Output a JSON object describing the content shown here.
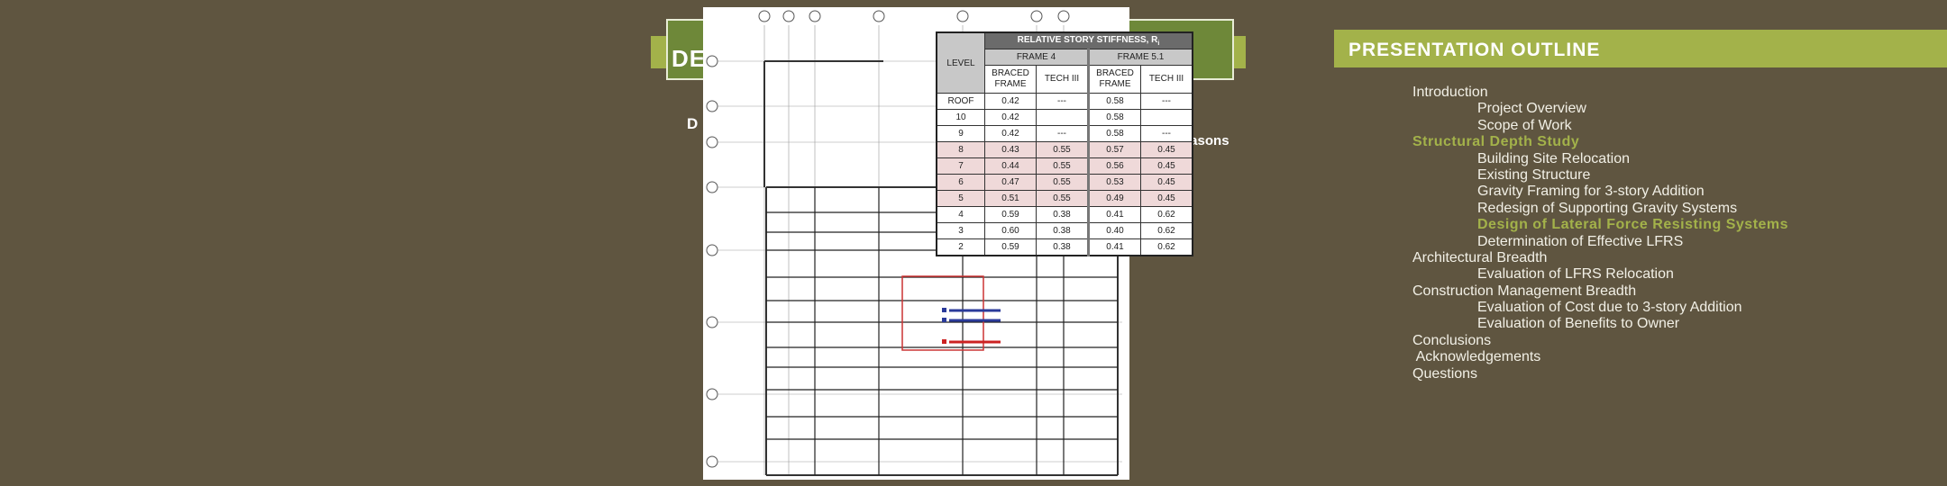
{
  "colors": {
    "background": "#5f5540",
    "accent_green": "#a3b24a",
    "dark_green": "#6e8839",
    "highlight_row": "#efd9d9"
  },
  "left_slide": {
    "title_fragment": "DE",
    "subtitle_fragment": "D",
    "body_fragment": "reasons"
  },
  "stiffness_table": {
    "title": "RELATIVE STORY STIFFNESS, R",
    "title_subscript": "i",
    "level_header": "LEVEL",
    "groups": [
      "FRAME 4",
      "FRAME 5.1"
    ],
    "subheaders": [
      "BRACED FRAME",
      "TECH III",
      "BRACED FRAME",
      "TECH III"
    ],
    "rows": [
      {
        "level": "ROOF",
        "values": [
          "0.42",
          "---",
          "0.58",
          "---"
        ],
        "highlight": false
      },
      {
        "level": "10",
        "values": [
          "0.42",
          "",
          "0.58",
          ""
        ],
        "highlight": false
      },
      {
        "level": "9",
        "values": [
          "0.42",
          "---",
          "0.58",
          "---"
        ],
        "highlight": false
      },
      {
        "level": "8",
        "values": [
          "0.43",
          "0.55",
          "0.57",
          "0.45"
        ],
        "highlight": true
      },
      {
        "level": "7",
        "values": [
          "0.44",
          "0.55",
          "0.56",
          "0.45"
        ],
        "highlight": true
      },
      {
        "level": "6",
        "values": [
          "0.47",
          "0.55",
          "0.53",
          "0.45"
        ],
        "highlight": true
      },
      {
        "level": "5",
        "values": [
          "0.51",
          "0.55",
          "0.49",
          "0.45"
        ],
        "highlight": true
      },
      {
        "level": "4",
        "values": [
          "0.59",
          "0.38",
          "0.41",
          "0.62"
        ],
        "highlight": false
      },
      {
        "level": "3",
        "values": [
          "0.60",
          "0.38",
          "0.40",
          "0.62"
        ],
        "highlight": false
      },
      {
        "level": "2",
        "values": [
          "0.59",
          "0.38",
          "0.41",
          "0.62"
        ],
        "highlight": false
      }
    ]
  },
  "outline": {
    "title": "PRESENTATION OUTLINE",
    "items": [
      {
        "text": "Introduction",
        "level": 0,
        "highlight": false
      },
      {
        "text": "Project Overview",
        "level": 1,
        "highlight": false
      },
      {
        "text": "Scope of Work",
        "level": 1,
        "highlight": false
      },
      {
        "text": "Structural Depth Study",
        "level": 0,
        "highlight": true
      },
      {
        "text": "Building Site Relocation",
        "level": 1,
        "highlight": false
      },
      {
        "text": "Existing Structure",
        "level": 1,
        "highlight": false
      },
      {
        "text": "Gravity Framing for 3-story Addition",
        "level": 1,
        "highlight": false
      },
      {
        "text": "Redesign of Supporting Gravity Systems",
        "level": 1,
        "highlight": false
      },
      {
        "text": "Design of Lateral Force Resisting Systems",
        "level": 1,
        "highlight": true
      },
      {
        "text": "Determination of Effective LFRS",
        "level": 1,
        "highlight": false
      },
      {
        "text": "Architectural Breadth",
        "level": 0,
        "highlight": false
      },
      {
        "text": "Evaluation of LFRS Relocation",
        "level": 1,
        "highlight": false
      },
      {
        "text": "Construction Management Breadth",
        "level": 0,
        "highlight": false
      },
      {
        "text": "Evaluation of Cost due to 3-story Addition",
        "level": 1,
        "highlight": false
      },
      {
        "text": "Evaluation of Benefits to Owner",
        "level": 1,
        "highlight": false
      },
      {
        "text": "Conclusions",
        "level": 0,
        "highlight": false
      },
      {
        "text": " Acknowledgements",
        "level": 0,
        "highlight": false
      },
      {
        "text": "Questions",
        "level": 0,
        "highlight": false
      }
    ]
  }
}
